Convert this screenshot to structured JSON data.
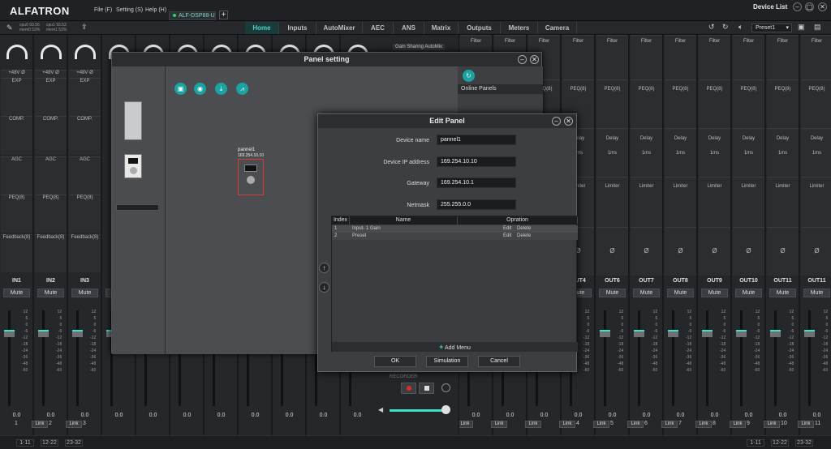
{
  "app": {
    "logo": "ALFATRON",
    "menus": [
      "File (F)",
      "Setting (S)",
      "Help (H)"
    ],
    "device_tab": "ALF-DSP88-U",
    "add_tab": "+",
    "device_list": "Device List",
    "cpu_lines": [
      "cpu0 93.56",
      "mem0 53%",
      "cpu1 93.53",
      "mem1 53%"
    ]
  },
  "toolbar": {
    "tabs": [
      "Home",
      "Inputs",
      "AutoMixer",
      "AEC",
      "ANS",
      "Matrix",
      "Outputs",
      "Meters",
      "Camera"
    ],
    "active_tab": "Home",
    "preset": "Preset1"
  },
  "inputs": {
    "names": [
      "IN1",
      "IN2",
      "IN3"
    ],
    "phantom": "+48V",
    "blocks": [
      "EXP",
      "COMP.",
      "AGC",
      "PEQ(8)",
      "Feedback(8)"
    ],
    "mute": "Mute",
    "value": "0.0",
    "numbers": [
      "1",
      "2",
      "3"
    ],
    "link": "Link",
    "scale": [
      "12",
      "6",
      "0",
      "-6",
      "-12",
      "-18",
      "-24",
      "-36",
      "-48",
      "-60"
    ]
  },
  "outputs": {
    "names": [
      "OUT4",
      "OUT6",
      "OUT7",
      "OUT8",
      "OUT9",
      "OUT10",
      "OUT11"
    ],
    "blocks": [
      "Filter",
      "PEQ(8)",
      "Delay",
      "1ms",
      "Limiter"
    ],
    "mute": "Mute",
    "value": "0.0",
    "numbers": [
      "4",
      "5",
      "6",
      "7",
      "8",
      "9",
      "10",
      "11"
    ],
    "link": "Link",
    "scale": [
      "12",
      "6",
      "0",
      "-6",
      "-12",
      "-18",
      "-24",
      "-36",
      "-48",
      "-60"
    ]
  },
  "center": {
    "gain_sharing": "Gain Sharing AutoMix",
    "recorder": "RECORDER"
  },
  "bottom": {
    "pages_left": [
      "1-11",
      "12-22",
      "23-32"
    ],
    "pages_right": [
      "1-11",
      "12-22",
      "23-32"
    ]
  },
  "panel_setting": {
    "title": "Panel setting",
    "online_panels": "Online Panels",
    "widget_name": "pannel1",
    "widget_ip": "169.254.10.10"
  },
  "edit_panel": {
    "title": "Edit Panel",
    "fields": [
      {
        "label": "Device name",
        "value": "pannel1"
      },
      {
        "label": "Device IP address",
        "value": "169.254.10.10"
      },
      {
        "label": "Gateway",
        "value": "169.254.10.1"
      },
      {
        "label": "Netmask",
        "value": "255.255.0.0"
      }
    ],
    "table_headers": [
      "Index",
      "Name",
      "Opration"
    ],
    "rows": [
      {
        "index": "1",
        "name": "Input- 1 Gain",
        "edit": "Edit",
        "delete": "Delete"
      },
      {
        "index": "2",
        "name": "Preset",
        "edit": "Edit",
        "delete": "Delete"
      }
    ],
    "add_menu": "Add Menu",
    "buttons": {
      "ok": "OK",
      "simulation": "Simulation",
      "cancel": "Cancel"
    }
  }
}
